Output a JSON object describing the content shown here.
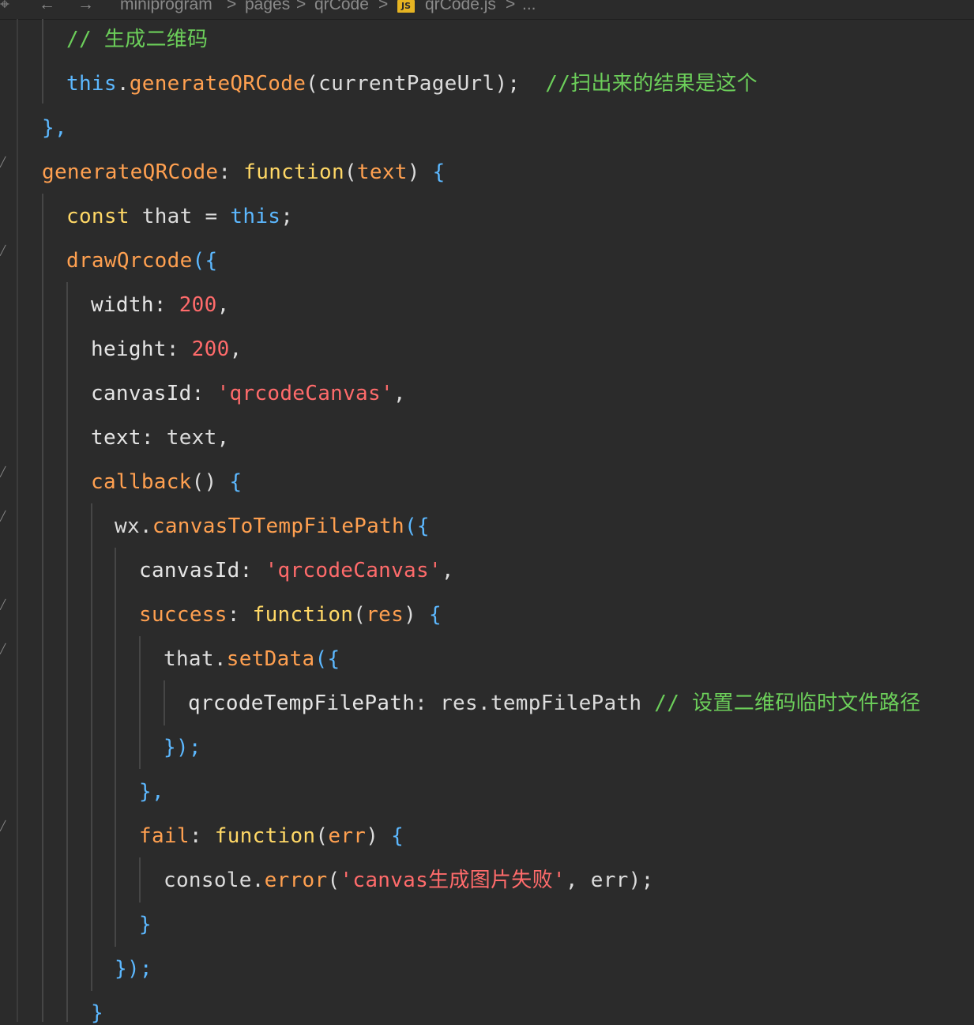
{
  "breadcrumb": {
    "back_icon": "←",
    "forward_icon": "→",
    "items": [
      "miniprogram",
      "pages",
      "qrCode",
      "qrCode.js",
      "..."
    ],
    "separator": ">",
    "file_badge": "JS"
  },
  "code": {
    "lines": [
      [
        {
          "t": "// 生成二维码",
          "c": "cm"
        }
      ],
      [
        {
          "t": "this",
          "c": "th"
        },
        {
          "t": ".",
          "c": "pl"
        },
        {
          "t": "generateQRCode",
          "c": "fn"
        },
        {
          "t": "(currentPageUrl);",
          "c": "pl"
        },
        {
          "t": "  //扫出来的结果是这个",
          "c": "cm"
        }
      ],
      [
        {
          "t": "},",
          "c": "br"
        }
      ],
      [
        {
          "t": "generateQRCode",
          "c": "fn"
        },
        {
          "t": ": ",
          "c": "pl"
        },
        {
          "t": "function",
          "c": "kw"
        },
        {
          "t": "(",
          "c": "pl"
        },
        {
          "t": "text",
          "c": "fn"
        },
        {
          "t": ") ",
          "c": "pl"
        },
        {
          "t": "{",
          "c": "br"
        }
      ],
      [
        {
          "t": "const",
          "c": "kw"
        },
        {
          "t": " that = ",
          "c": "pl"
        },
        {
          "t": "this",
          "c": "th"
        },
        {
          "t": ";",
          "c": "pl"
        }
      ],
      [
        {
          "t": "drawQrcode",
          "c": "fn"
        },
        {
          "t": "({",
          "c": "br"
        }
      ],
      [
        {
          "t": "width",
          "c": "pr"
        },
        {
          "t": ": ",
          "c": "pl"
        },
        {
          "t": "200",
          "c": "num"
        },
        {
          "t": ",",
          "c": "pl"
        }
      ],
      [
        {
          "t": "height",
          "c": "pr"
        },
        {
          "t": ": ",
          "c": "pl"
        },
        {
          "t": "200",
          "c": "num"
        },
        {
          "t": ",",
          "c": "pl"
        }
      ],
      [
        {
          "t": "canvasId",
          "c": "pr"
        },
        {
          "t": ": ",
          "c": "pl"
        },
        {
          "t": "'qrcodeCanvas'",
          "c": "str"
        },
        {
          "t": ",",
          "c": "pl"
        }
      ],
      [
        {
          "t": "text",
          "c": "pr"
        },
        {
          "t": ": text,",
          "c": "pl"
        }
      ],
      [
        {
          "t": "callback",
          "c": "fn"
        },
        {
          "t": "() ",
          "c": "pl"
        },
        {
          "t": "{",
          "c": "br"
        }
      ],
      [
        {
          "t": "wx",
          "c": "pl"
        },
        {
          "t": ".",
          "c": "pl"
        },
        {
          "t": "canvasToTempFilePath",
          "c": "fn"
        },
        {
          "t": "({",
          "c": "br"
        }
      ],
      [
        {
          "t": "canvasId",
          "c": "pr"
        },
        {
          "t": ": ",
          "c": "pl"
        },
        {
          "t": "'qrcodeCanvas'",
          "c": "str"
        },
        {
          "t": ",",
          "c": "pl"
        }
      ],
      [
        {
          "t": "success",
          "c": "fn"
        },
        {
          "t": ": ",
          "c": "pl"
        },
        {
          "t": "function",
          "c": "kw"
        },
        {
          "t": "(",
          "c": "pl"
        },
        {
          "t": "res",
          "c": "fn"
        },
        {
          "t": ") ",
          "c": "pl"
        },
        {
          "t": "{",
          "c": "br"
        }
      ],
      [
        {
          "t": "that",
          "c": "pl"
        },
        {
          "t": ".",
          "c": "pl"
        },
        {
          "t": "setData",
          "c": "fn"
        },
        {
          "t": "({",
          "c": "br"
        }
      ],
      [
        {
          "t": "qrcodeTempFilePath",
          "c": "pr"
        },
        {
          "t": ": res.tempFilePath ",
          "c": "pl"
        },
        {
          "t": "// 设置二维码临时文件路径",
          "c": "cm"
        }
      ],
      [
        {
          "t": "});",
          "c": "br"
        }
      ],
      [
        {
          "t": "},",
          "c": "br"
        }
      ],
      [
        {
          "t": "fail",
          "c": "fn"
        },
        {
          "t": ": ",
          "c": "pl"
        },
        {
          "t": "function",
          "c": "kw"
        },
        {
          "t": "(",
          "c": "pl"
        },
        {
          "t": "err",
          "c": "fn"
        },
        {
          "t": ") ",
          "c": "pl"
        },
        {
          "t": "{",
          "c": "br"
        }
      ],
      [
        {
          "t": "console",
          "c": "pl"
        },
        {
          "t": ".",
          "c": "pl"
        },
        {
          "t": "error",
          "c": "fn"
        },
        {
          "t": "(",
          "c": "pl"
        },
        {
          "t": "'canvas生成图片失败'",
          "c": "str"
        },
        {
          "t": ", err);",
          "c": "pl"
        }
      ],
      [
        {
          "t": "}",
          "c": "br"
        }
      ],
      [
        {
          "t": "});",
          "c": "br"
        }
      ],
      [
        {
          "t": "}",
          "c": "br"
        }
      ]
    ]
  },
  "colors": {
    "background": "#2b2b2b",
    "keyword": "#ffd866",
    "function": "#ffa050",
    "string": "#ff6b6b",
    "comment": "#6ccf5a",
    "this": "#5cb8ff"
  }
}
